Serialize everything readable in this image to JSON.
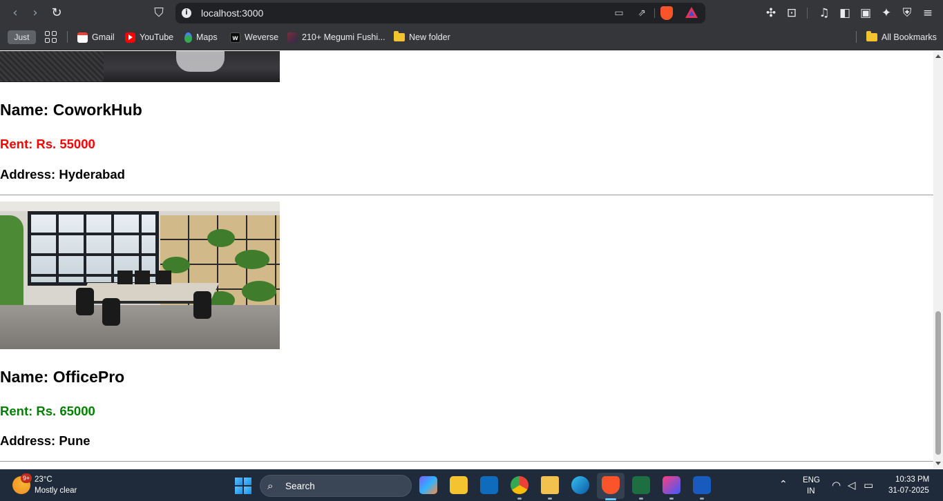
{
  "browser": {
    "url": "localhost:3000",
    "bookmarks": [
      {
        "label": "Just",
        "icon": "just-chip"
      },
      {
        "label": "Gmail",
        "icon": "gmail-icon"
      },
      {
        "label": "YouTube",
        "icon": "youtube-icon"
      },
      {
        "label": "Maps",
        "icon": "maps-icon"
      },
      {
        "label": "Weverse",
        "icon": "weverse-icon"
      },
      {
        "label": "210+ Megumi Fushi...",
        "icon": "image-favicon"
      },
      {
        "label": "New folder",
        "icon": "folder-icon"
      }
    ],
    "all_bookmarks_label": "All Bookmarks",
    "weverse_glyph": "w"
  },
  "listings": [
    {
      "name": "Name: CoworkHub",
      "rent": "Rent: Rs. 55000",
      "rent_color": "#ff0000",
      "address": "Address: Hyderabad"
    },
    {
      "name": "Name: OfficePro",
      "rent": "Rent: Rs. 65000",
      "rent_color": "#008000",
      "address": "Address: Pune"
    }
  ],
  "taskbar": {
    "weather_badge": "9+",
    "temperature": "23°C",
    "weather": "Mostly clear",
    "search_label": "Search",
    "language": "ENG",
    "region": "IN",
    "time": "10:33 PM",
    "date": "31-07-2025"
  },
  "colors": {
    "chrome_bg": "#35363a",
    "omnibox_bg": "#202124",
    "taskbar_bg": "#1f2b3b",
    "accent_active": "#60cdff"
  }
}
